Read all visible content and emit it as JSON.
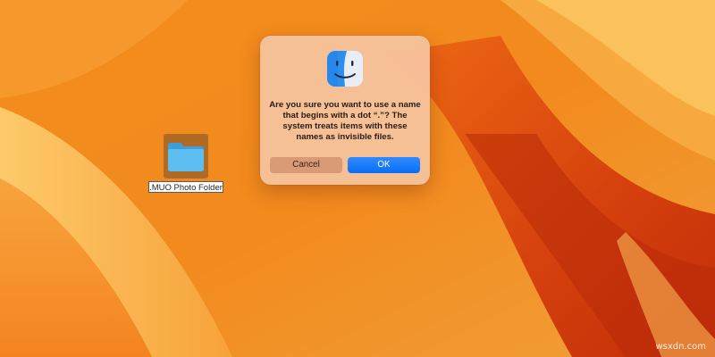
{
  "desktop": {
    "wallpaper": {
      "name": "macos-ventura-wallpaper",
      "colors": [
        "#f4901e",
        "#fbbf5c",
        "#e45a12",
        "#c9320a"
      ]
    },
    "items": [
      {
        "label": ".MUO Photo Folder",
        "icon": "folder-icon",
        "selected": true,
        "colors": {
          "folder": "#57b8ee",
          "selection": "#7a5030"
        }
      }
    ]
  },
  "dialog": {
    "icon": "finder-icon",
    "message": "Are you sure you want to use a name that begins with a dot “.”? The system treats items with these names as invisible files.",
    "cancel_label": "Cancel",
    "ok_label": "OK",
    "colors": {
      "background": "#f6c4a0",
      "ok_button": "#0a6ef5",
      "cancel_button": "#d99a76"
    }
  },
  "watermark": "wsxdn.com"
}
